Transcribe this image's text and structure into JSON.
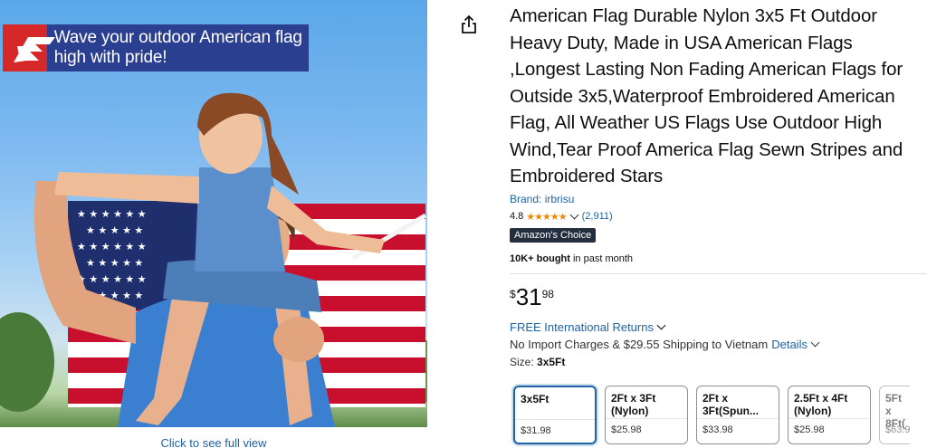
{
  "image": {
    "banner_text": "Wave your outdoor American flag high with pride!",
    "see_full_view": "Click to see full view"
  },
  "share_icon": "share-icon",
  "product": {
    "title": "American Flag Durable Nylon 3x5 Ft Outdoor Heavy Duty, Made in USA American Flags ,Longest Lasting Non Fading American Flags for Outside 3x5,Waterproof Embroidered American Flag, All Weather US Flags Use Outdoor High Wind,Tear Proof America Flag Sewn Stripes and Embroidered Stars",
    "brand": "Brand: irbrisu",
    "rating": "4.8",
    "stars": "★★★★★",
    "rating_count": "(2,911)",
    "badge": "Amazon's Choice",
    "bought_bold": "10K+ bought",
    "bought_rest": " in past month",
    "price_currency": "$",
    "price_whole": "31",
    "price_fraction": "98",
    "returns": "FREE International Returns",
    "shipping": "No Import Charges & $29.55 Shipping to Vietnam",
    "details": "Details",
    "size_label": "Size: ",
    "size_value": "3x5Ft"
  },
  "size_options": [
    {
      "name": "3x5Ft",
      "price": "$31.98",
      "selected": true
    },
    {
      "name": "2Ft x 3Ft (Nylon)",
      "price": "$25.98"
    },
    {
      "name": "2Ft x 3Ft(Spun...",
      "price": "$33.98"
    },
    {
      "name": "2.5Ft x 4Ft (Nylon)",
      "price": "$25.98"
    },
    {
      "name": "5Ft x 8Ft(",
      "price": "$63.9"
    }
  ],
  "colors": {
    "link": "#2162a1",
    "star": "#f08804",
    "badge_bg": "#232f3e",
    "banner_bg": "#2a3f8f"
  }
}
